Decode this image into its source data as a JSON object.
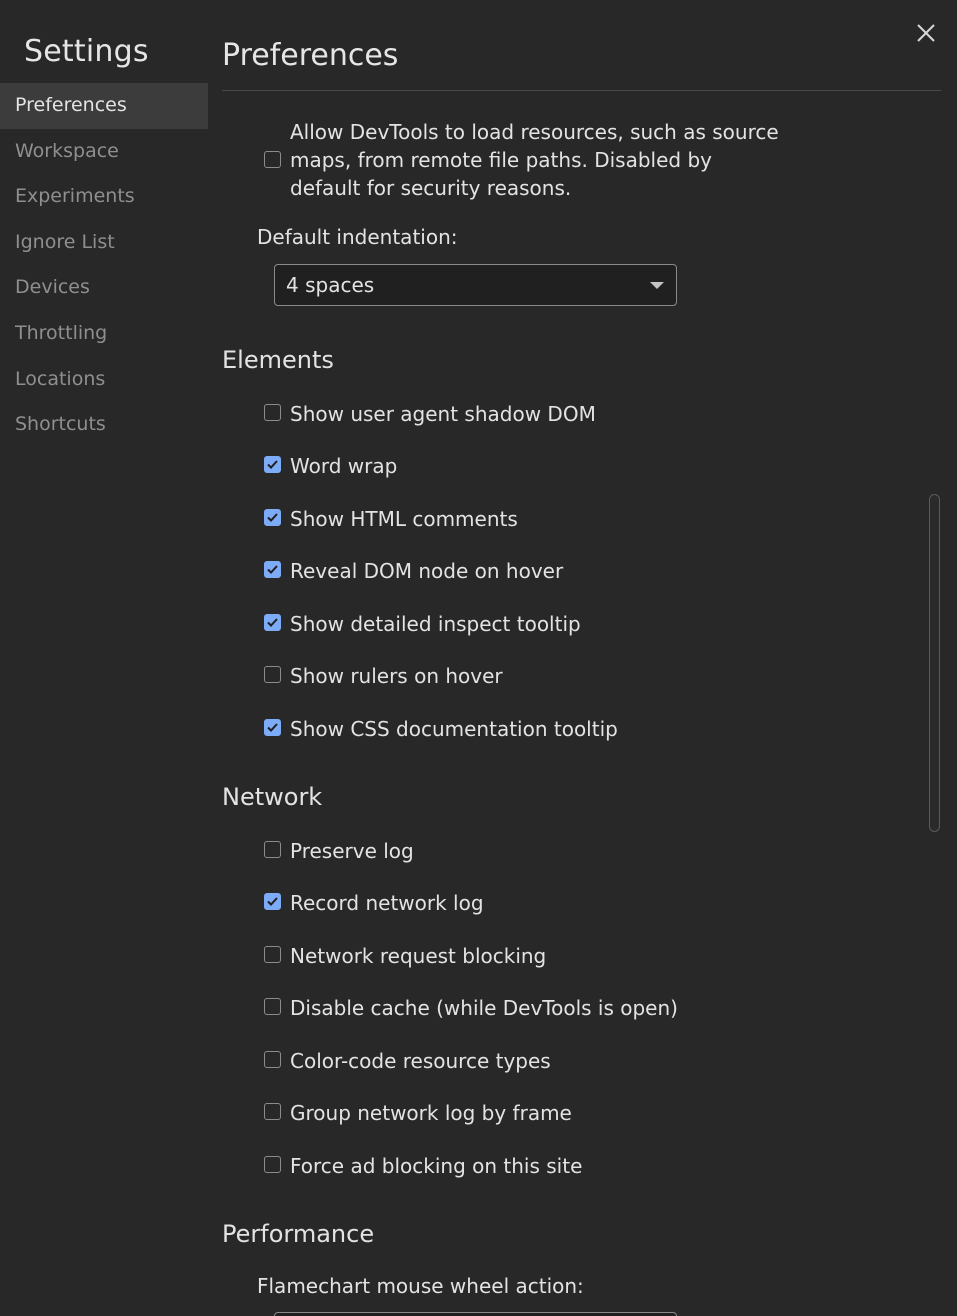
{
  "sidebar": {
    "title": "Settings",
    "items": [
      {
        "label": "Preferences",
        "active": true
      },
      {
        "label": "Workspace"
      },
      {
        "label": "Experiments"
      },
      {
        "label": "Ignore List"
      },
      {
        "label": "Devices"
      },
      {
        "label": "Throttling"
      },
      {
        "label": "Locations"
      },
      {
        "label": "Shortcuts"
      }
    ]
  },
  "main": {
    "title": "Preferences",
    "close_icon": "close-icon",
    "remote_paths": {
      "lines": [
        "Allow DevTools to load resources, such as source",
        "maps, from remote file paths. Disabled by",
        "default for security reasons."
      ],
      "checked": false
    },
    "indentation": {
      "label": "Default indentation:",
      "value": "4 spaces"
    },
    "sections": {
      "elements": {
        "title": "Elements",
        "options": [
          {
            "label": "Show user agent shadow DOM",
            "checked": false
          },
          {
            "label": "Word wrap",
            "checked": true
          },
          {
            "label": "Show HTML comments",
            "checked": true
          },
          {
            "label": "Reveal DOM node on hover",
            "checked": true
          },
          {
            "label": "Show detailed inspect tooltip",
            "checked": true
          },
          {
            "label": "Show rulers on hover",
            "checked": false
          },
          {
            "label": "Show CSS documentation tooltip",
            "checked": true
          }
        ]
      },
      "network": {
        "title": "Network",
        "options": [
          {
            "label": "Preserve log",
            "checked": false
          },
          {
            "label": "Record network log",
            "checked": true
          },
          {
            "label": "Network request blocking",
            "checked": false
          },
          {
            "label": "Disable cache (while DevTools is open)",
            "checked": false
          },
          {
            "label": "Color-code resource types",
            "checked": false
          },
          {
            "label": "Group network log by frame",
            "checked": false
          },
          {
            "label": "Force ad blocking on this site",
            "checked": false
          }
        ]
      },
      "performance": {
        "title": "Performance",
        "flamechart_label": "Flamechart mouse wheel action:"
      }
    }
  },
  "colors": {
    "background": "#282828",
    "accent": "#7cacf8",
    "sidebar_active": "#3c3c3c",
    "muted_text": "#8f8f8f"
  }
}
